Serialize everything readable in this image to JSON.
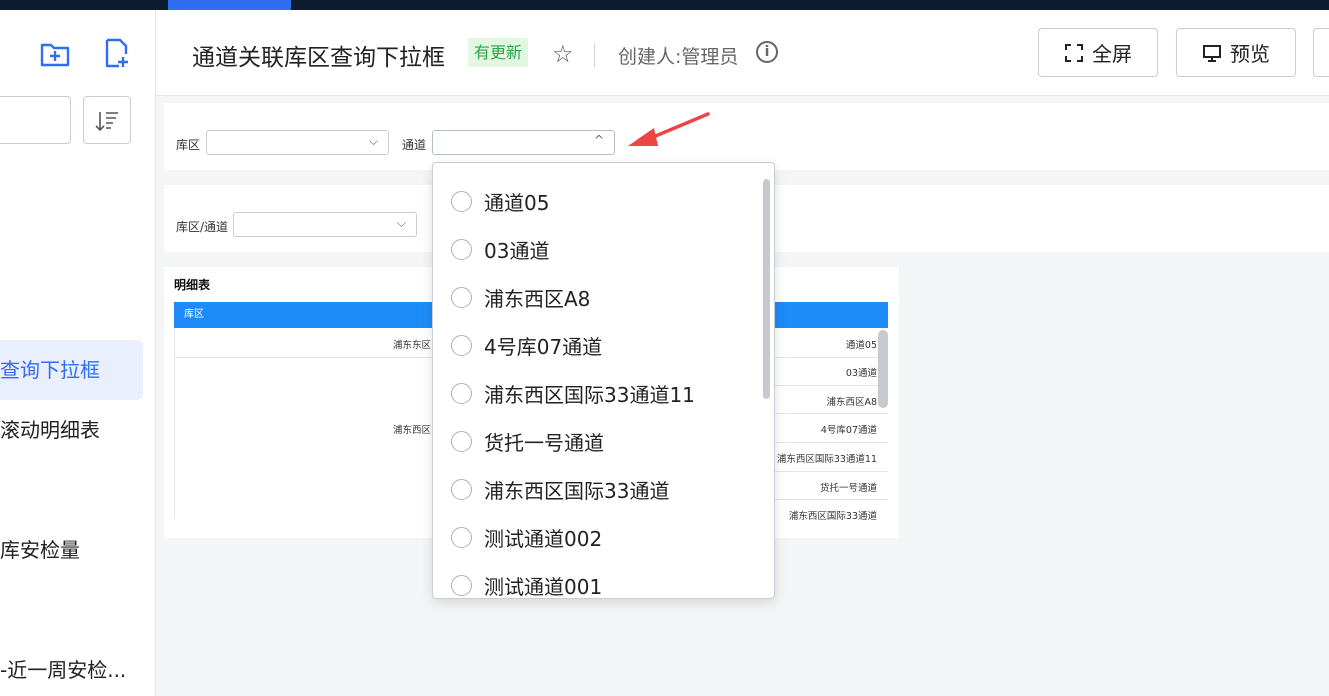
{
  "header": {
    "title": "通道关联库区查询下拉框",
    "badge": "有更新",
    "creator": "创建人:管理员",
    "fullscreen_label": "全屏",
    "preview_label": "预览"
  },
  "sidebar": {
    "items": [
      {
        "label": "查询下拉框"
      },
      {
        "label": "滚动明细表"
      },
      {
        "label": "库安检量"
      },
      {
        "label": "-近一周安检..."
      }
    ]
  },
  "filters": {
    "area_label": "库区",
    "channel_label": "通道",
    "area_channel_label": "库区/通道"
  },
  "table": {
    "title": "明细表",
    "header": "库区",
    "area_cells": [
      "浦东东区",
      "浦东西区"
    ],
    "channel_cells": [
      "通道05",
      "03通道",
      "浦东西区A8",
      "4号库07通道",
      "浦东西区国际33通道11",
      "货托一号通道",
      "浦东西区国际33通道"
    ]
  },
  "dropdown": {
    "options": [
      {
        "label": "通道05"
      },
      {
        "label": "03通道"
      },
      {
        "label": "浦东西区A8"
      },
      {
        "label": "4号库07通道"
      },
      {
        "label": "浦东西区国际33通道11"
      },
      {
        "label": "货托一号通道"
      },
      {
        "label": "浦东西区国际33通道"
      },
      {
        "label": "测试通道002"
      },
      {
        "label": "测试通道001"
      }
    ]
  },
  "colors": {
    "accent": "#2f6ef0",
    "table_header": "#1d8cf8",
    "badge_bg": "#e3f6e1",
    "badge_text": "#2aa844",
    "arrow": "#ee4444"
  }
}
